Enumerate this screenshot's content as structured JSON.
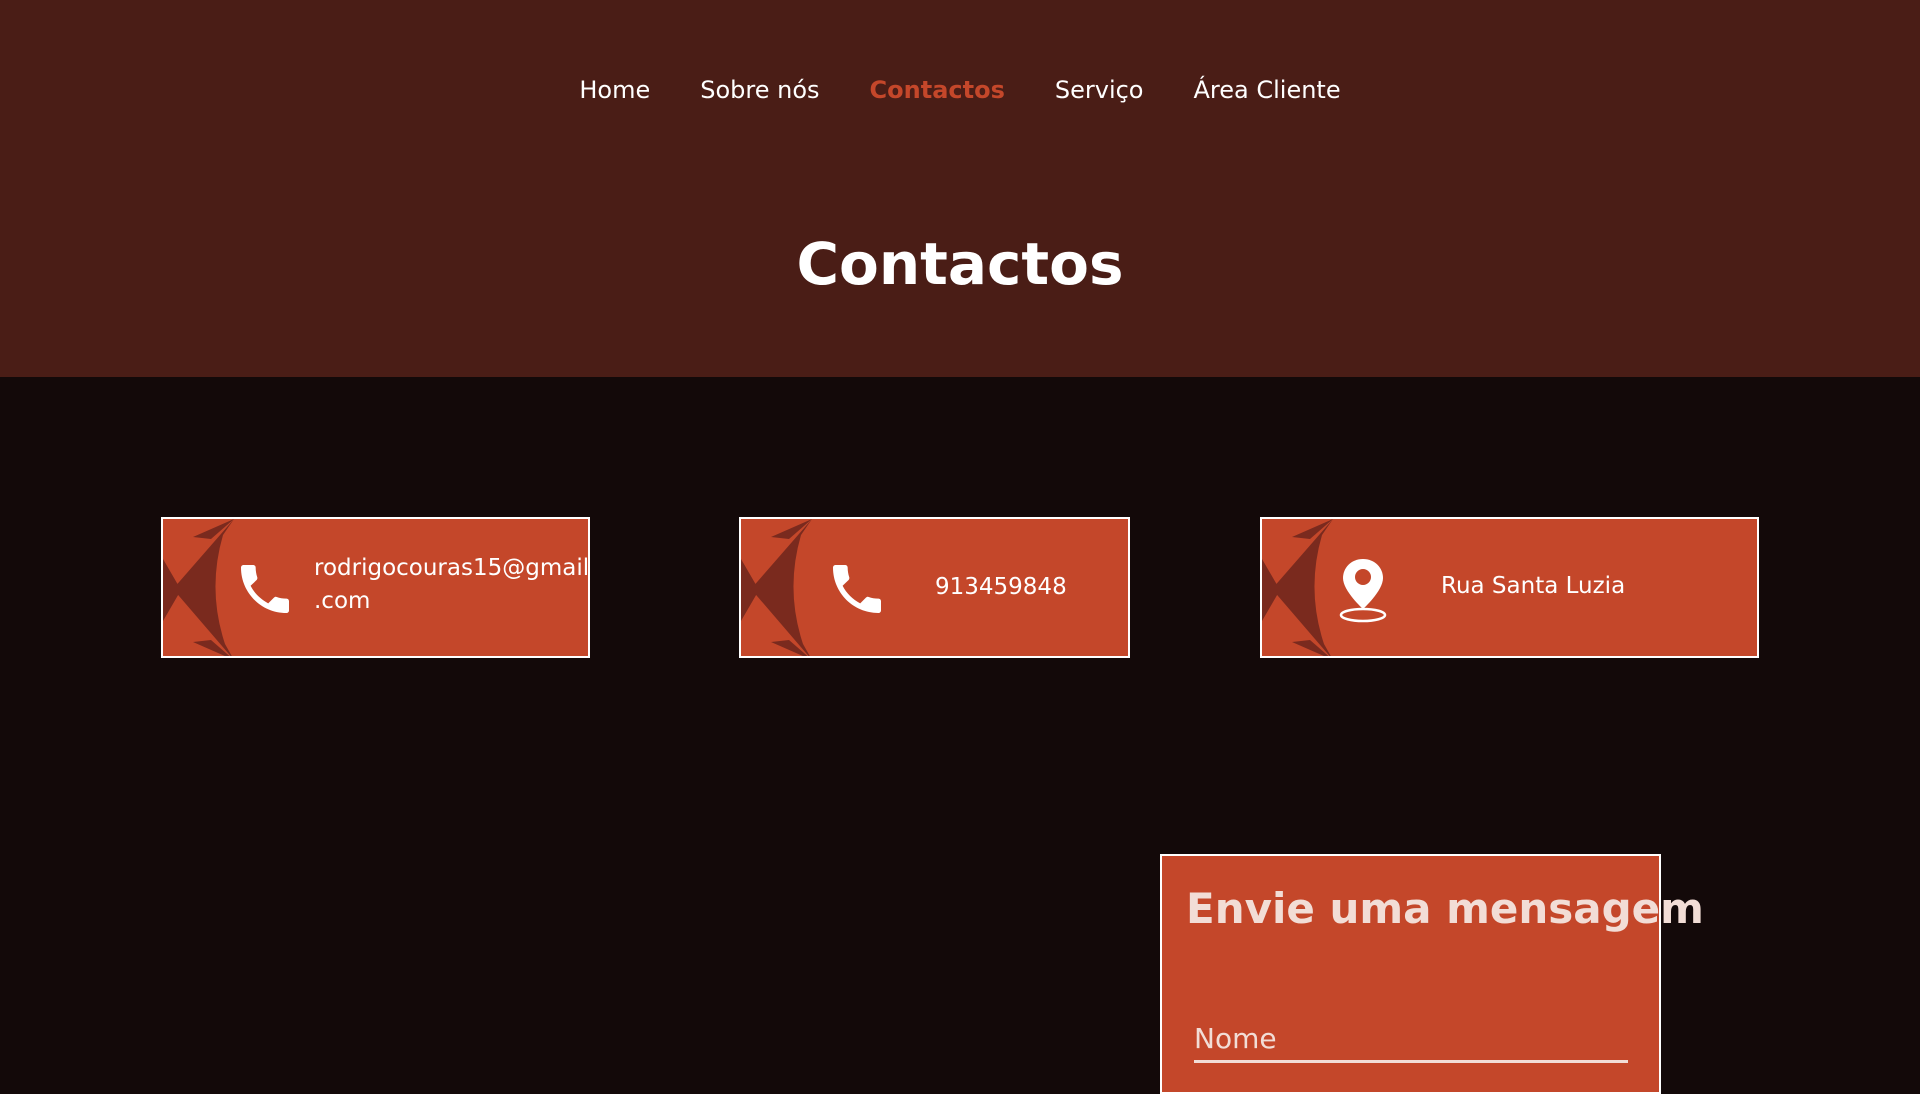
{
  "nav": {
    "items": [
      {
        "label": "Home",
        "active": false
      },
      {
        "label": "Sobre nós",
        "active": false
      },
      {
        "label": "Contactos",
        "active": true
      },
      {
        "label": "Serviço",
        "active": false
      },
      {
        "label": "Área Cliente",
        "active": false
      }
    ]
  },
  "header": {
    "title": "Contactos"
  },
  "contacts": {
    "email": {
      "line1": "rodrigocouras15@gmail",
      "line2": ".com",
      "icon": "phone-icon"
    },
    "phone": {
      "value": "913459848",
      "icon": "phone-icon"
    },
    "address": {
      "value": "Rua Santa Luzia",
      "icon": "map-pin-icon"
    }
  },
  "form": {
    "title": "Envie uma mensagem",
    "name_placeholder": "Nome"
  },
  "colors": {
    "header_bg": "#4a1d16",
    "page_bg": "#130909",
    "accent": "#c4472a",
    "deco": "#7a2a1e"
  }
}
